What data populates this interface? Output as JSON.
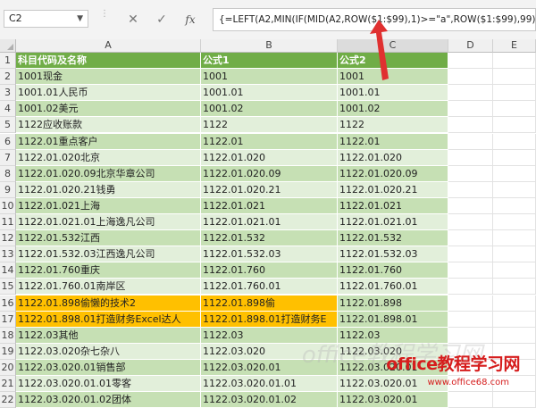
{
  "formula_bar": {
    "name_box": "C2",
    "cancel_icon": "✕",
    "enter_icon": "✓",
    "fx_label": "fx",
    "formula": "{=LEFT(A2,MIN(IF(MID(A2,ROW($1:$99),1)>=\"a\",ROW($1:$99),99))-1)}"
  },
  "columns": [
    "A",
    "B",
    "C",
    "D",
    "E"
  ],
  "colors": {
    "header_fill": "#70ad47",
    "band_dark": "#c6e0b4",
    "band_light": "#e2efda",
    "highlight_orange": "#ffc000",
    "watermark_red": "#d61d1d"
  },
  "rows": [
    {
      "n": "1",
      "a": "科目代码及名称",
      "b": "公式1",
      "c": "公式2",
      "style": "header"
    },
    {
      "n": "2",
      "a": "1001现金",
      "b": "1001",
      "c": "1001",
      "style": "dark"
    },
    {
      "n": "3",
      "a": "1001.01人民币",
      "b": "1001.01",
      "c": "1001.01",
      "style": "light"
    },
    {
      "n": "4",
      "a": "1001.02美元",
      "b": "1001.02",
      "c": "1001.02",
      "style": "dark"
    },
    {
      "n": "5",
      "a": "1122应收账款",
      "b": "1122",
      "c": "1122",
      "style": "light"
    },
    {
      "n": "6",
      "a": "1122.01重点客户",
      "b": "1122.01",
      "c": "1122.01",
      "style": "dark"
    },
    {
      "n": "7",
      "a": "1122.01.020北京",
      "b": "1122.01.020",
      "c": "1122.01.020",
      "style": "light"
    },
    {
      "n": "8",
      "a": "1122.01.020.09北京华章公司",
      "b": "1122.01.020.09",
      "c": "1122.01.020.09",
      "style": "dark"
    },
    {
      "n": "9",
      "a": "1122.01.020.21钱勇",
      "b": "1122.01.020.21",
      "c": "1122.01.020.21",
      "style": "light"
    },
    {
      "n": "10",
      "a": "1122.01.021上海",
      "b": "1122.01.021",
      "c": "1122.01.021",
      "style": "dark"
    },
    {
      "n": "11",
      "a": "1122.01.021.01上海逸凡公司",
      "b": "1122.01.021.01",
      "c": "1122.01.021.01",
      "style": "light"
    },
    {
      "n": "12",
      "a": "1122.01.532江西",
      "b": "1122.01.532",
      "c": "1122.01.532",
      "style": "dark"
    },
    {
      "n": "13",
      "a": "1122.01.532.03江西逸凡公司",
      "b": "1122.01.532.03",
      "c": "1122.01.532.03",
      "style": "light"
    },
    {
      "n": "14",
      "a": "1122.01.760重庆",
      "b": "1122.01.760",
      "c": "1122.01.760",
      "style": "dark"
    },
    {
      "n": "15",
      "a": "1122.01.760.01南岸区",
      "b": "1122.01.760.01",
      "c": "1122.01.760.01",
      "style": "light"
    },
    {
      "n": "16",
      "a": "1122.01.898偷懒的技术2",
      "b": "1122.01.898偷",
      "c": "1122.01.898",
      "style": "orange"
    },
    {
      "n": "17",
      "a": "1122.01.898.01打造财务Excel达人",
      "b": "1122.01.898.01打造财务E",
      "c": "1122.01.898.01",
      "style": "orange"
    },
    {
      "n": "18",
      "a": "1122.03其他",
      "b": "1122.03",
      "c": "1122.03",
      "style": "dark"
    },
    {
      "n": "19",
      "a": "1122.03.020杂七杂八",
      "b": "1122.03.020",
      "c": "1122.03.020",
      "style": "light"
    },
    {
      "n": "20",
      "a": "1122.03.020.01销售部",
      "b": "1122.03.020.01",
      "c": "1122.03.020.01",
      "style": "dark"
    },
    {
      "n": "21",
      "a": "1122.03.020.01.01零客",
      "b": "1122.03.020.01.01",
      "c": "1122.03.020.01",
      "style": "light"
    },
    {
      "n": "22",
      "a": "1122.03.020.01.02团体",
      "b": "1122.03.020.01.02",
      "c": "1122.03.020.01",
      "style": "dark"
    }
  ],
  "watermark": {
    "main": "office教程学习网",
    "url": "www.office68.com"
  }
}
